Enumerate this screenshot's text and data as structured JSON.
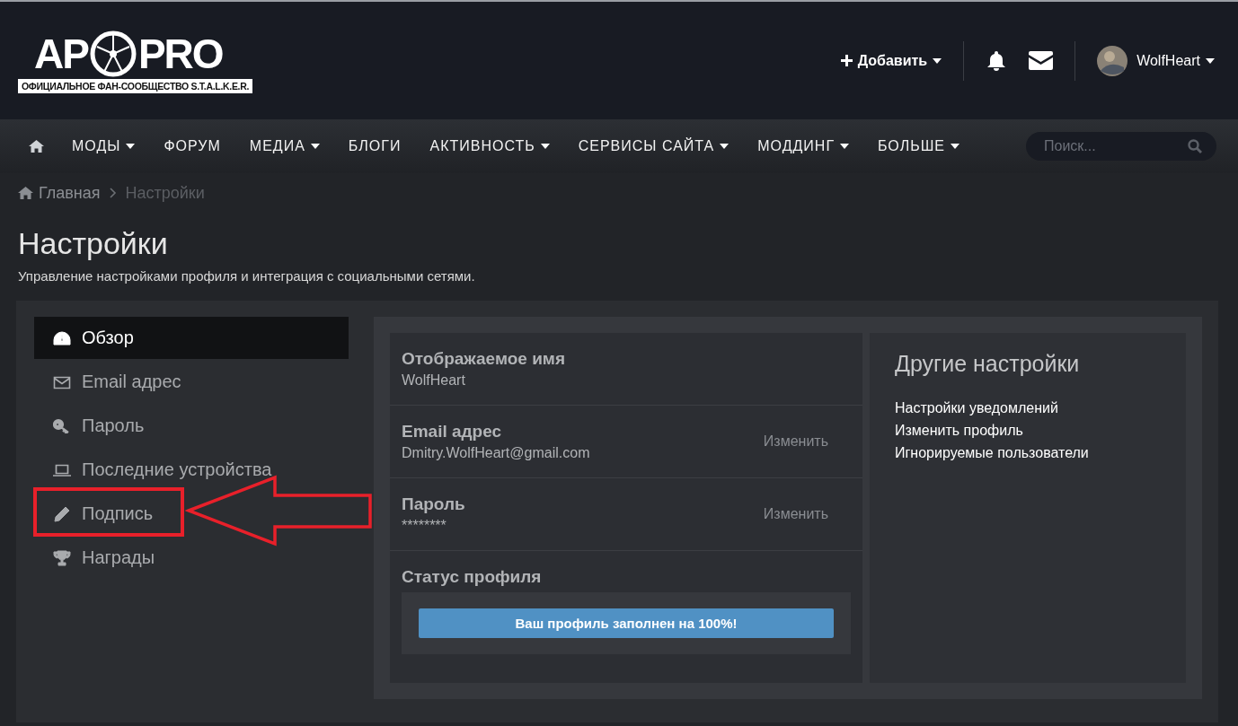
{
  "header": {
    "logo": {
      "left": "AP",
      "right": "PRO",
      "tagline": "ОФИЦИАЛЬНОЕ ФАН-СООБЩЕСТВО S.T.A.L.K.E.R."
    },
    "add_label": "Добавить",
    "user": "WolfHeart"
  },
  "nav": {
    "items": [
      {
        "label": "МОДЫ",
        "dropdown": true
      },
      {
        "label": "ФОРУМ",
        "dropdown": false
      },
      {
        "label": "МЕДИА",
        "dropdown": true
      },
      {
        "label": "БЛОГИ",
        "dropdown": false
      },
      {
        "label": "АКТИВНОСТЬ",
        "dropdown": true
      },
      {
        "label": "СЕРВИСЫ САЙТА",
        "dropdown": true
      },
      {
        "label": "МОДДИНГ",
        "dropdown": true
      },
      {
        "label": "БОЛЬШЕ",
        "dropdown": true
      }
    ],
    "search": {
      "placeholder": "Поиск..."
    }
  },
  "breadcrumb": [
    "Главная",
    "Настройки"
  ],
  "page": {
    "title": "Настройки",
    "description": "Управление настройками профиля и интеграция с социальными сетями."
  },
  "sidebar": {
    "items": [
      {
        "label": "Обзор",
        "selected": true,
        "annotated": false
      },
      {
        "label": "Email адрес",
        "selected": false,
        "annotated": false
      },
      {
        "label": "Пароль",
        "selected": false,
        "annotated": false
      },
      {
        "label": "Последние устройства",
        "selected": false,
        "annotated": false
      },
      {
        "label": "Подпись",
        "selected": false,
        "annotated": true
      },
      {
        "label": "Награды",
        "selected": false,
        "annotated": false
      }
    ]
  },
  "fields": [
    {
      "label": "Отображаемое имя",
      "value": "WolfHeart"
    },
    {
      "label": "Email адрес",
      "value": "Dmitry.WolfHeart@gmail.com",
      "action": "Изменить"
    },
    {
      "label": "Пароль",
      "value": "********",
      "action": "Изменить"
    }
  ],
  "status": {
    "label": "Статус профиля",
    "text": "Ваш профиль заполнен на 100%!",
    "level": 1
  },
  "other": {
    "title": "Другие настройки",
    "links": [
      "Настройки уведомлений",
      "Изменить профиль",
      "Игнорируемые пользователи"
    ]
  }
}
